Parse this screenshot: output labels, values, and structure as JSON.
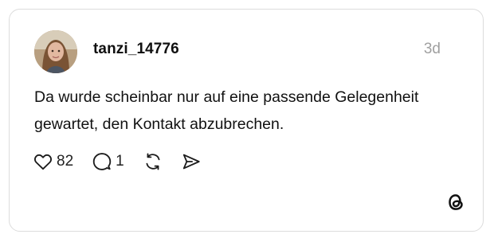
{
  "post": {
    "username": "tanzi_14776",
    "timestamp": "3d",
    "text": "Da wurde scheinbar nur auf eine passende Gelegenheit gewartet, den Kontakt abzubrechen.",
    "likes": "82",
    "replies": "1"
  },
  "icons": {
    "like": "heart-icon",
    "reply": "speech-bubble-icon",
    "repost": "repost-arrows-icon",
    "share": "send-paper-plane-icon",
    "brand": "threads-logo-icon"
  },
  "colors": {
    "text": "#111111",
    "muted": "#a0a0a0",
    "border": "#dcdcdc"
  }
}
